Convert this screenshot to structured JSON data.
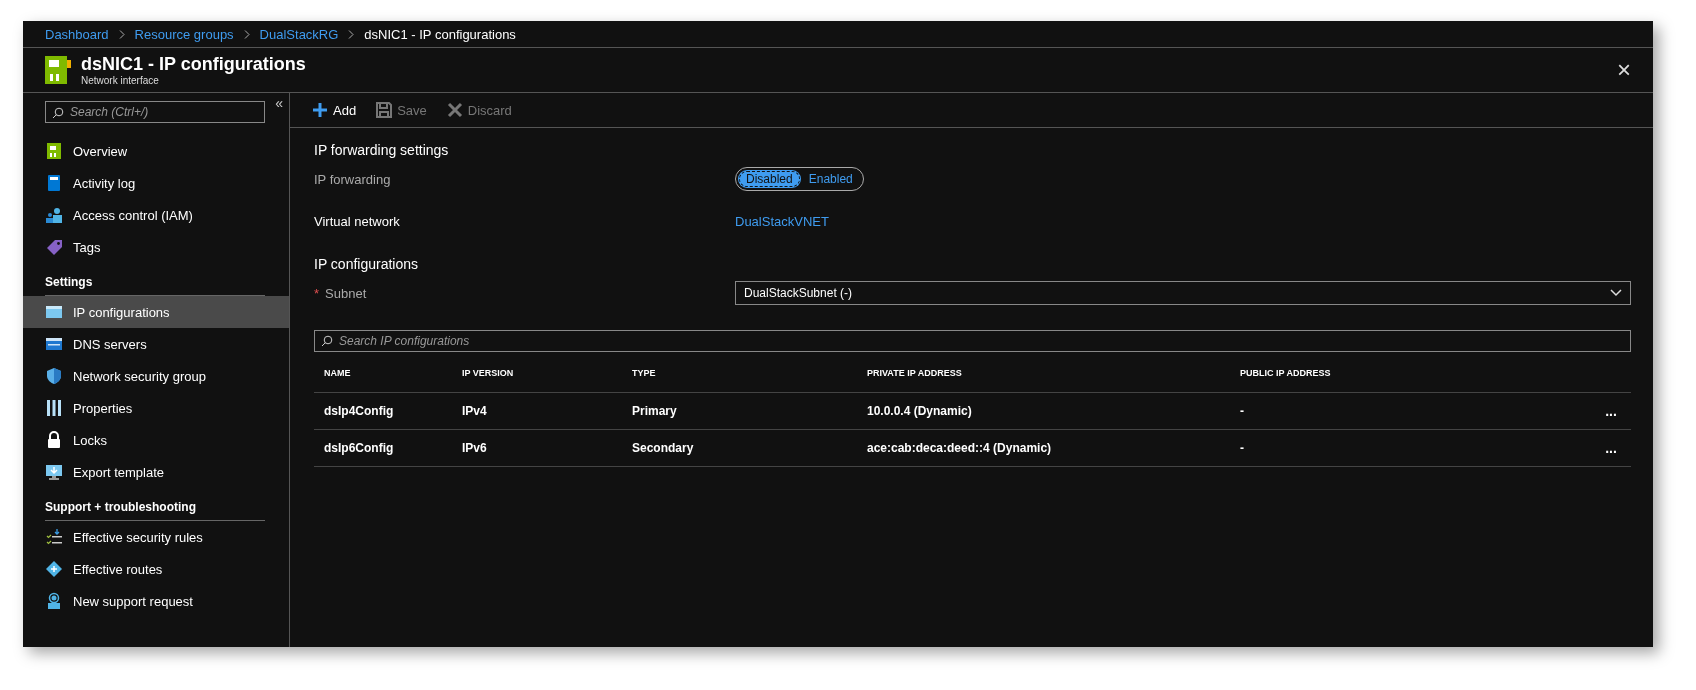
{
  "breadcrumb": [
    {
      "label": "Dashboard",
      "link": true
    },
    {
      "label": "Resource groups",
      "link": true
    },
    {
      "label": "DualStackRG",
      "link": true
    },
    {
      "label": "dsNIC1 - IP configurations",
      "link": false
    }
  ],
  "header": {
    "title": "dsNIC1 - IP configurations",
    "subtitle": "Network interface",
    "close": "×"
  },
  "sidebar": {
    "search_placeholder": "Search (Ctrl+/)",
    "collapse": "«",
    "items": [
      {
        "kind": "item",
        "label": "Overview",
        "selected": false
      },
      {
        "kind": "item",
        "label": "Activity log",
        "selected": false
      },
      {
        "kind": "item",
        "label": "Access control (IAM)",
        "selected": false
      },
      {
        "kind": "item",
        "label": "Tags",
        "selected": false
      },
      {
        "kind": "header",
        "label": "Settings"
      },
      {
        "kind": "item",
        "label": "IP configurations",
        "selected": true
      },
      {
        "kind": "item",
        "label": "DNS servers",
        "selected": false
      },
      {
        "kind": "item",
        "label": "Network security group",
        "selected": false
      },
      {
        "kind": "item",
        "label": "Properties",
        "selected": false
      },
      {
        "kind": "item",
        "label": "Locks",
        "selected": false
      },
      {
        "kind": "item",
        "label": "Export template",
        "selected": false
      },
      {
        "kind": "header",
        "label": "Support + troubleshooting"
      },
      {
        "kind": "item",
        "label": "Effective security rules",
        "selected": false
      },
      {
        "kind": "item",
        "label": "Effective routes",
        "selected": false
      },
      {
        "kind": "item",
        "label": "New support request",
        "selected": false
      }
    ]
  },
  "toolbar": [
    {
      "label": "Add",
      "disabled": false
    },
    {
      "label": "Save",
      "disabled": true
    },
    {
      "label": "Discard",
      "disabled": true
    }
  ],
  "ip_forwarding": {
    "heading": "IP forwarding settings",
    "label": "IP forwarding",
    "options": [
      {
        "label": "Disabled",
        "selected": true
      },
      {
        "label": "Enabled",
        "selected": false
      }
    ]
  },
  "virtual_network": {
    "label": "Virtual network",
    "value": "DualStackVNET"
  },
  "ip_configurations": {
    "heading": "IP configurations",
    "subnet_label": "Subnet",
    "required": true,
    "required_mark": "*",
    "subnet_value": "DualStackSubnet (-)",
    "search_placeholder": "Search IP configurations",
    "columns": [
      "NAME",
      "IP VERSION",
      "TYPE",
      "PRIVATE IP ADDRESS",
      "PUBLIC IP ADDRESS"
    ],
    "rows": [
      {
        "cells": [
          "dsIp4Config",
          "IPv4",
          "Primary",
          "10.0.0.4 (Dynamic)",
          "-"
        ],
        "more": "..."
      },
      {
        "cells": [
          "dsIp6Config",
          "IPv6",
          "Secondary",
          "ace:cab:deca:deed::4 (Dynamic)",
          "-"
        ],
        "more": "..."
      }
    ]
  }
}
